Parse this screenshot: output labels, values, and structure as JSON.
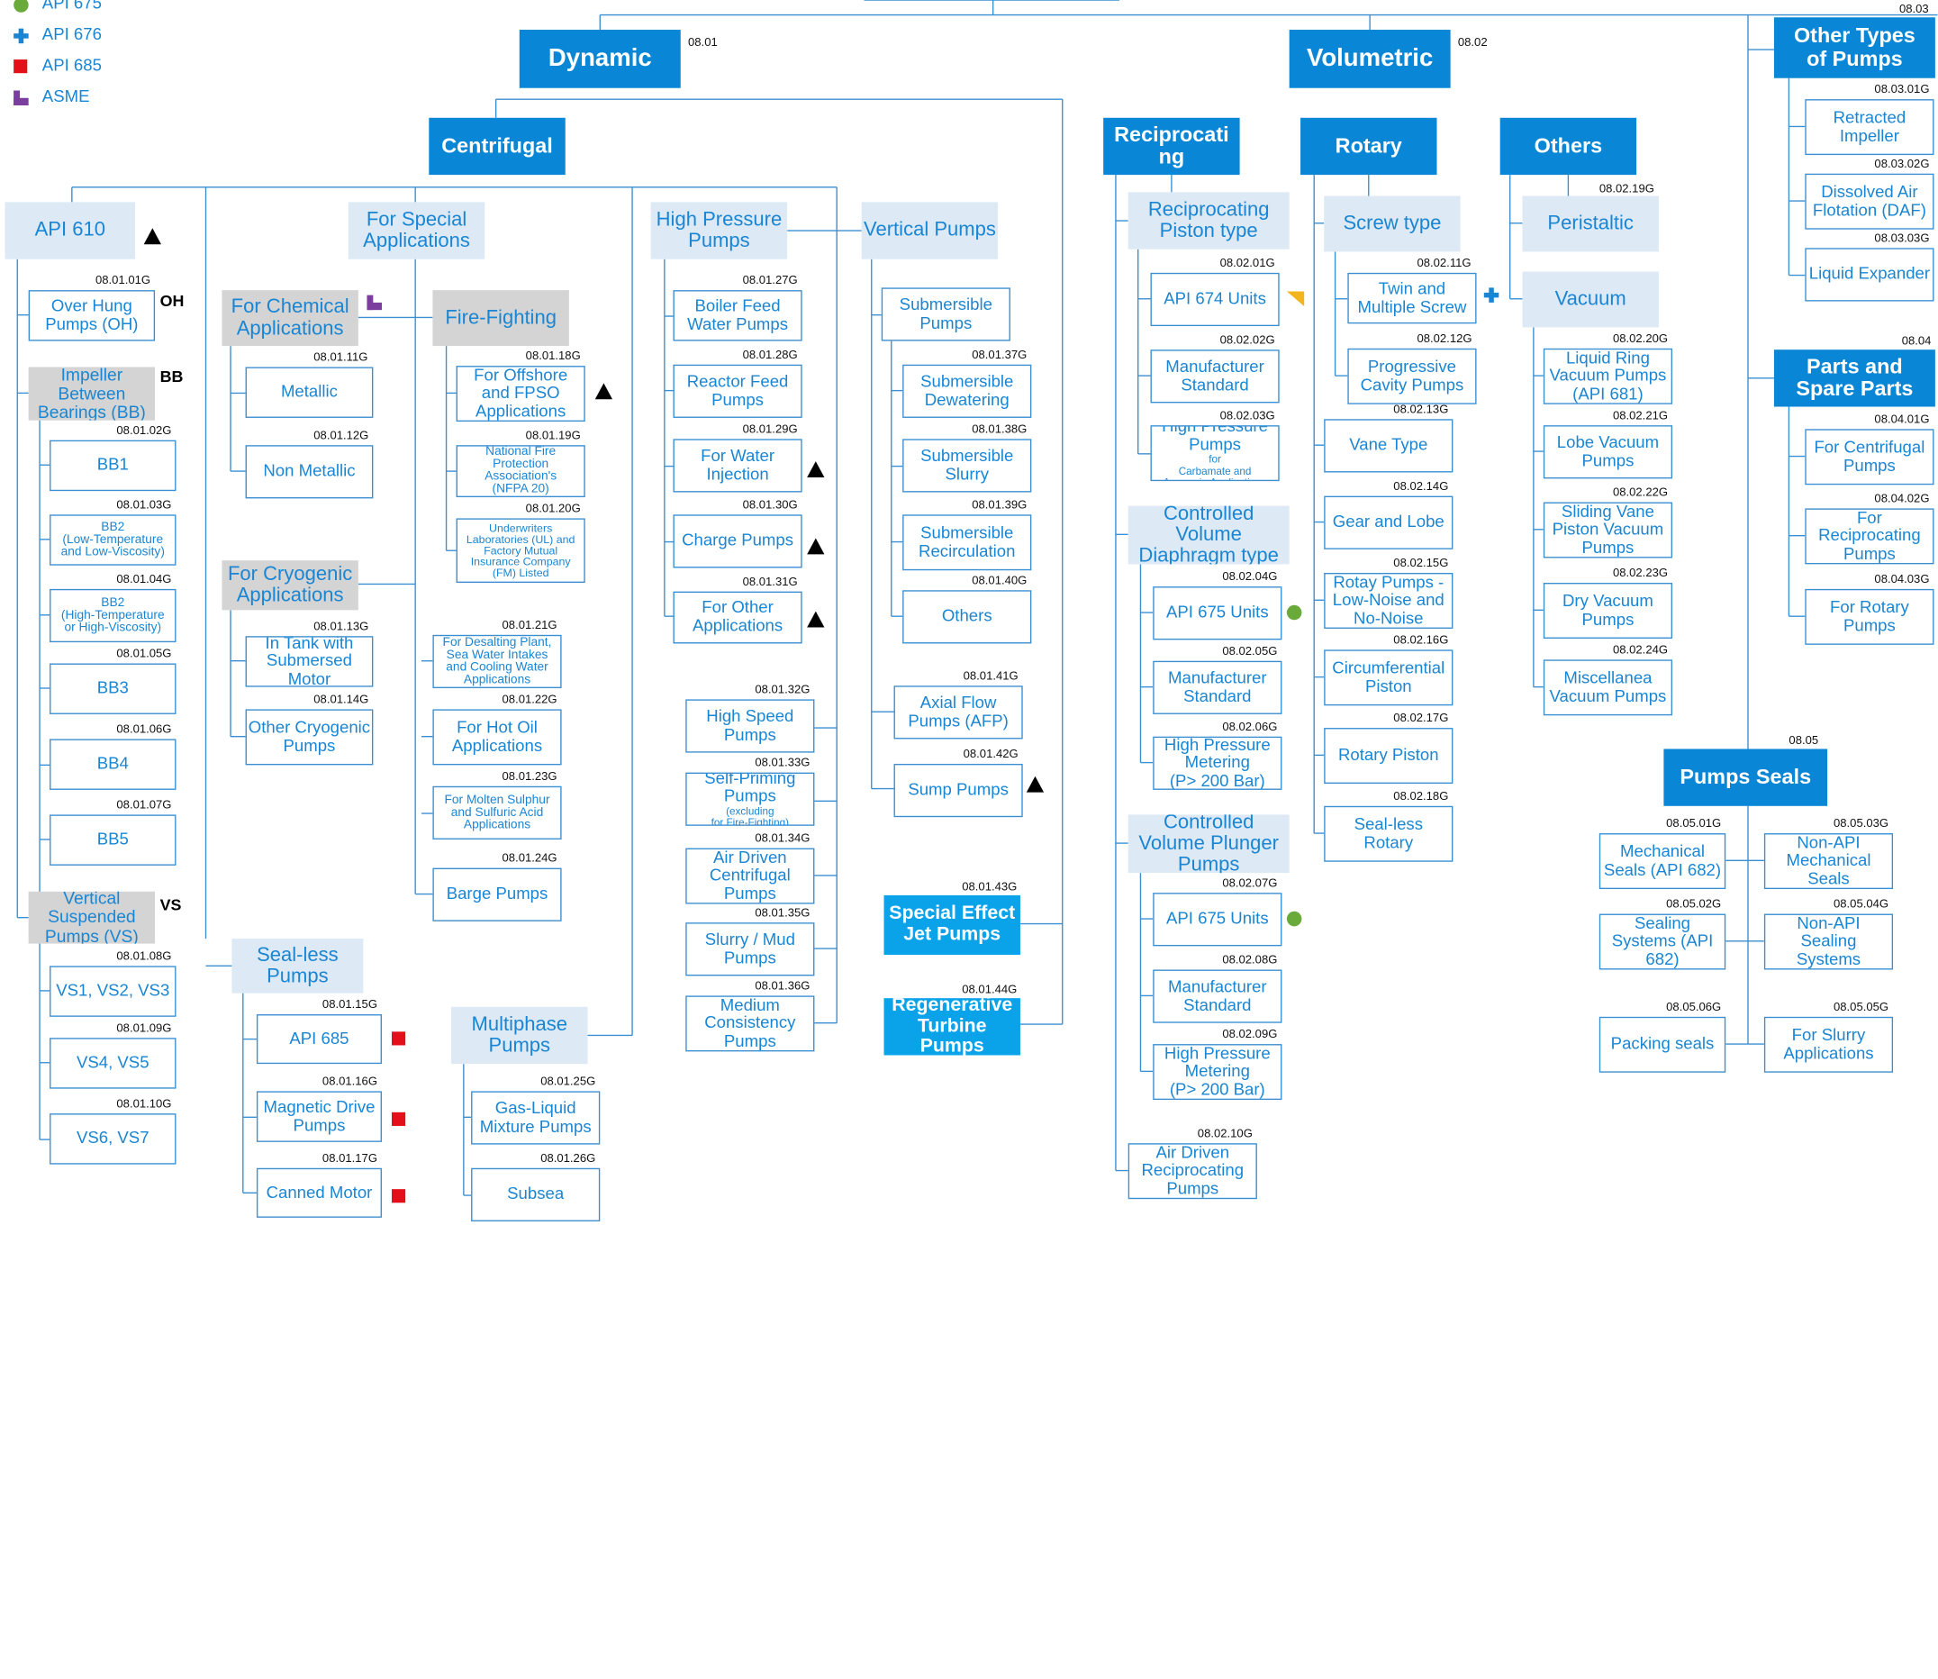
{
  "legend": [
    {
      "label": "API 675",
      "icon": "green-dot-icon"
    },
    {
      "label": "API 676",
      "icon": "blue-plus-icon"
    },
    {
      "label": "API 685",
      "icon": "red-square-icon"
    },
    {
      "label": "ASME",
      "icon": "purple-l-icon"
    }
  ],
  "colors": {
    "primary": "#0a86d6",
    "accent": "#0aa3ea",
    "line": "#3a8fd3",
    "label_bg": "#dde9f5",
    "grey_bg": "#d4d4d4",
    "api675": "#6aaa3a",
    "api676": "#1a86d3",
    "api685": "#e41019",
    "asme": "#7b3d9e"
  },
  "categories": {
    "dynamic": "Dynamic",
    "dynamic_code": "08.01",
    "volumetric": "Volumetric",
    "volumetric_code": "08.02",
    "other_types": "Other Types\nof Pumps",
    "other_types_code": "08.03",
    "parts": "Parts and\nSpare Parts",
    "parts_code": "08.04",
    "seals": "Pumps Seals",
    "seals_code": "08.05"
  },
  "subheads": {
    "centrifugal": "Centrifugal",
    "reciprocating": "Reciprocati\nng",
    "rotary": "Rotary",
    "others": "Others",
    "special_jet": "Special Effect\nJet Pumps",
    "special_jet_code": "08.01.43G",
    "regen_turbine": "Regenerative\nTurbine\nPumps",
    "regen_turbine_code": "08.01.44G"
  },
  "groups": {
    "api610": "API 610",
    "special_apps": "For Special\nApplications",
    "high_pressure": "High Pressure\nPumps",
    "vertical": "Vertical Pumps",
    "chemical": "For Chemical\nApplications",
    "fire_fighting": "Fire-Fighting",
    "cryogenic": "For Cryogenic\nApplications",
    "sealless": "Seal-less\nPumps",
    "multiphase": "Multiphase\nPumps",
    "overhung_group": "Impeller\nBetween\nBearings (BB)",
    "vs_group": "Vertical\nSuspended\nPumps (VS)",
    "recip_piston": "Reciprocating\nPiston type",
    "ctrl_diaphragm": "Controlled\nVolume\nDiaphragm type",
    "ctrl_plunger": "Controlled\nVolume Plunger\nPumps",
    "screw": "Screw type",
    "peristaltic": "Peristaltic",
    "peristaltic_code": "08.02.19G",
    "vacuum": "Vacuum"
  },
  "tags": {
    "oh": "OH",
    "bb": "BB",
    "vs": "VS"
  },
  "items": {
    "oh": {
      "label": "Over Hung\nPumps (OH)",
      "code": "08.01.01G"
    },
    "bb1": {
      "label": "BB1",
      "code": "08.01.02G"
    },
    "bb2lt": {
      "label": "BB2\n(Low-Temperature\nand Low-Viscosity)",
      "code": "08.01.03G"
    },
    "bb2ht": {
      "label": "BB2\n(High-Temperature\nor High-Viscosity)",
      "code": "08.01.04G"
    },
    "bb3": {
      "label": "BB3",
      "code": "08.01.05G"
    },
    "bb4": {
      "label": "BB4",
      "code": "08.01.06G"
    },
    "bb5": {
      "label": "BB5",
      "code": "08.01.07G"
    },
    "vs123": {
      "label": "VS1, VS2, VS3",
      "code": "08.01.08G"
    },
    "vs45": {
      "label": "VS4, VS5",
      "code": "08.01.09G"
    },
    "vs67": {
      "label": "VS6, VS7",
      "code": "08.01.10G"
    },
    "metallic": {
      "label": "Metallic",
      "code": "08.01.11G"
    },
    "nonmetallic": {
      "label": "Non Metallic",
      "code": "08.01.12G"
    },
    "intank": {
      "label": "In Tank with\nSubmersed\nMotor",
      "code": "08.01.13G"
    },
    "othercryo": {
      "label": "Other Cryogenic\nPumps",
      "code": "08.01.14G"
    },
    "api685": {
      "label": "API 685",
      "code": "08.01.15G"
    },
    "magdrive": {
      "label": "Magnetic Drive\nPumps",
      "code": "08.01.16G"
    },
    "canned": {
      "label": "Canned Motor",
      "code": "08.01.17G"
    },
    "offshore": {
      "label": "For Offshore\nand FPSO\nApplications",
      "code": "08.01.18G"
    },
    "nfpa": {
      "label": "National Fire\nProtection\nAssociation's\n(NFPA 20)",
      "code": "08.01.19G"
    },
    "ul": {
      "label": "Underwriters\nLaboratories (UL) and\nFactory Mutual\nInsurance Company\n(FM) Listed",
      "code": "08.01.20G"
    },
    "desalting": {
      "label": "For Desalting Plant,\nSea Water Intakes\nand Cooling  Water\nApplications",
      "code": "08.01.21G"
    },
    "hotoil": {
      "label": "For Hot Oil\nApplications",
      "code": "08.01.22G"
    },
    "moltensulphur": {
      "label": "For Molten Sulphur\nand Sulfuric Acid\nApplications",
      "code": "08.01.23G"
    },
    "barge": {
      "label": "Barge Pumps",
      "code": "08.01.24G"
    },
    "gasliquid": {
      "label": "Gas-Liquid\nMixture Pumps",
      "code": "08.01.25G"
    },
    "subsea": {
      "label": "Subsea",
      "code": "08.01.26G"
    },
    "boilerfeed": {
      "label": "Boiler Feed\nWater Pumps",
      "code": "08.01.27G"
    },
    "reactorfeed": {
      "label": "Reactor Feed\nPumps",
      "code": "08.01.28G"
    },
    "waterinj": {
      "label": "For Water\nInjection",
      "code": "08.01.29G"
    },
    "charge": {
      "label": "Charge Pumps",
      "code": "08.01.30G"
    },
    "otherapps": {
      "label": "For Other\nApplications",
      "code": "08.01.31G"
    },
    "highspeed": {
      "label": "High Speed\nPumps",
      "code": "08.01.32G"
    },
    "selfpriming": {
      "label": "Self-Priming\nPumps",
      "sub": "(excluding\nfor Fire-Fighting)",
      "code": "08.01.33G"
    },
    "airdriven": {
      "label": "Air Driven\nCentrifugal\nPumps",
      "code": "08.01.34G"
    },
    "slurrymud": {
      "label": "Slurry / Mud\nPumps",
      "code": "08.01.35G"
    },
    "mediumcons": {
      "label": "Medium\nConsistency\nPumps",
      "code": "08.01.36G"
    },
    "submersible": {
      "label": "Submersible\nPumps"
    },
    "subdewater": {
      "label": "Submersible\nDewatering",
      "code": "08.01.37G"
    },
    "subslurry": {
      "label": "Submersible\nSlurry",
      "code": "08.01.38G"
    },
    "subrecirc": {
      "label": "Submersible\nRecirculation",
      "code": "08.01.39G"
    },
    "vothers": {
      "label": "Others",
      "code": "08.01.40G"
    },
    "axialflow": {
      "label": "Axial Flow\nPumps  (AFP)",
      "code": "08.01.41G"
    },
    "sump": {
      "label": "Sump Pumps",
      "code": "08.01.42G"
    },
    "api674": {
      "label": "API 674 Units",
      "code": "08.02.01G"
    },
    "mfr1": {
      "label": "Manufacturer\nStandard",
      "code": "08.02.02G"
    },
    "hpcarbamate": {
      "label": "High Pressure\nPumps",
      "sub": "for\nCarbamate and\nAmmonia Applications",
      "code": "08.02.03G"
    },
    "api675a": {
      "label": "API 675 Units",
      "code": "08.02.04G"
    },
    "mfr2": {
      "label": "Manufacturer\nStandard",
      "code": "08.02.05G"
    },
    "hpmeter1": {
      "label": "High Pressure\nMetering\n(P> 200 Bar)",
      "code": "08.02.06G"
    },
    "api675b": {
      "label": "API 675 Units",
      "code": "08.02.07G"
    },
    "mfr3": {
      "label": "Manufacturer\nStandard",
      "code": "08.02.08G"
    },
    "hpmeter2": {
      "label": "High Pressure\nMetering\n(P> 200 Bar)",
      "code": "08.02.09G"
    },
    "airrecip": {
      "label": "Air Driven\nReciprocating\nPumps",
      "code": "08.02.10G"
    },
    "twinscrew": {
      "label": "Twin and\nMultiple Screw",
      "code": "08.02.11G"
    },
    "progcavity": {
      "label": "Progressive\nCavity Pumps",
      "code": "08.02.12G"
    },
    "vane": {
      "label": "Vane Type",
      "code": "08.02.13G"
    },
    "gearlobe": {
      "label": "Gear and Lobe",
      "code": "08.02.14G"
    },
    "lownoise": {
      "label": "Rotay Pumps -\nLow-Noise and\nNo-Noise",
      "code": "08.02.15G"
    },
    "circpiston": {
      "label": "Circumferential\nPiston",
      "code": "08.02.16G"
    },
    "rotpiston": {
      "label": "Rotary Piston",
      "code": "08.02.17G"
    },
    "sealrotary": {
      "label": "Seal-less\nRotary",
      "code": "08.02.18G"
    },
    "liquidring": {
      "label": "Liquid Ring\nVacuum Pumps\n(API 681)",
      "code": "08.02.20G"
    },
    "lobevac": {
      "label": "Lobe Vacuum\nPumps",
      "code": "08.02.21G"
    },
    "slidingvane": {
      "label": "Sliding Vane\nPiston Vacuum\nPumps",
      "code": "08.02.22G"
    },
    "dryvac": {
      "label": "Dry Vacuum\nPumps",
      "code": "08.02.23G"
    },
    "miscvac": {
      "label": "Miscellanea\nVacuum Pumps",
      "code": "08.02.24G"
    },
    "retracted": {
      "label": "Retracted\nImpeller",
      "code": "08.03.01G"
    },
    "daf": {
      "label": "Dissolved Air\nFlotation (DAF)",
      "code": "08.03.02G"
    },
    "liqexp": {
      "label": "Liquid Expander",
      "code": "08.03.03G"
    },
    "pcentrif": {
      "label": "For Centrifugal\nPumps",
      "code": "08.04.01G"
    },
    "precip": {
      "label": "For\nReciprocating\nPumps",
      "code": "08.04.02G"
    },
    "protary": {
      "label": "For Rotary\nPumps",
      "code": "08.04.03G"
    },
    "mechseal": {
      "label": "Mechanical\nSeals (API 682)",
      "code": "08.05.01G"
    },
    "sealsys": {
      "label": "Sealing\nSystems (API\n682)",
      "code": "08.05.02G"
    },
    "nonapimech": {
      "label": "Non-API\nMechanical\nSeals",
      "code": "08.05.03G"
    },
    "nonapisys": {
      "label": "Non-API\nSealing\nSystems",
      "code": "08.05.04G"
    },
    "slurryapp": {
      "label": "For Slurry\nApplications",
      "code": "08.05.05G"
    },
    "packing": {
      "label": "Packing seals",
      "code": "08.05.06G"
    }
  }
}
